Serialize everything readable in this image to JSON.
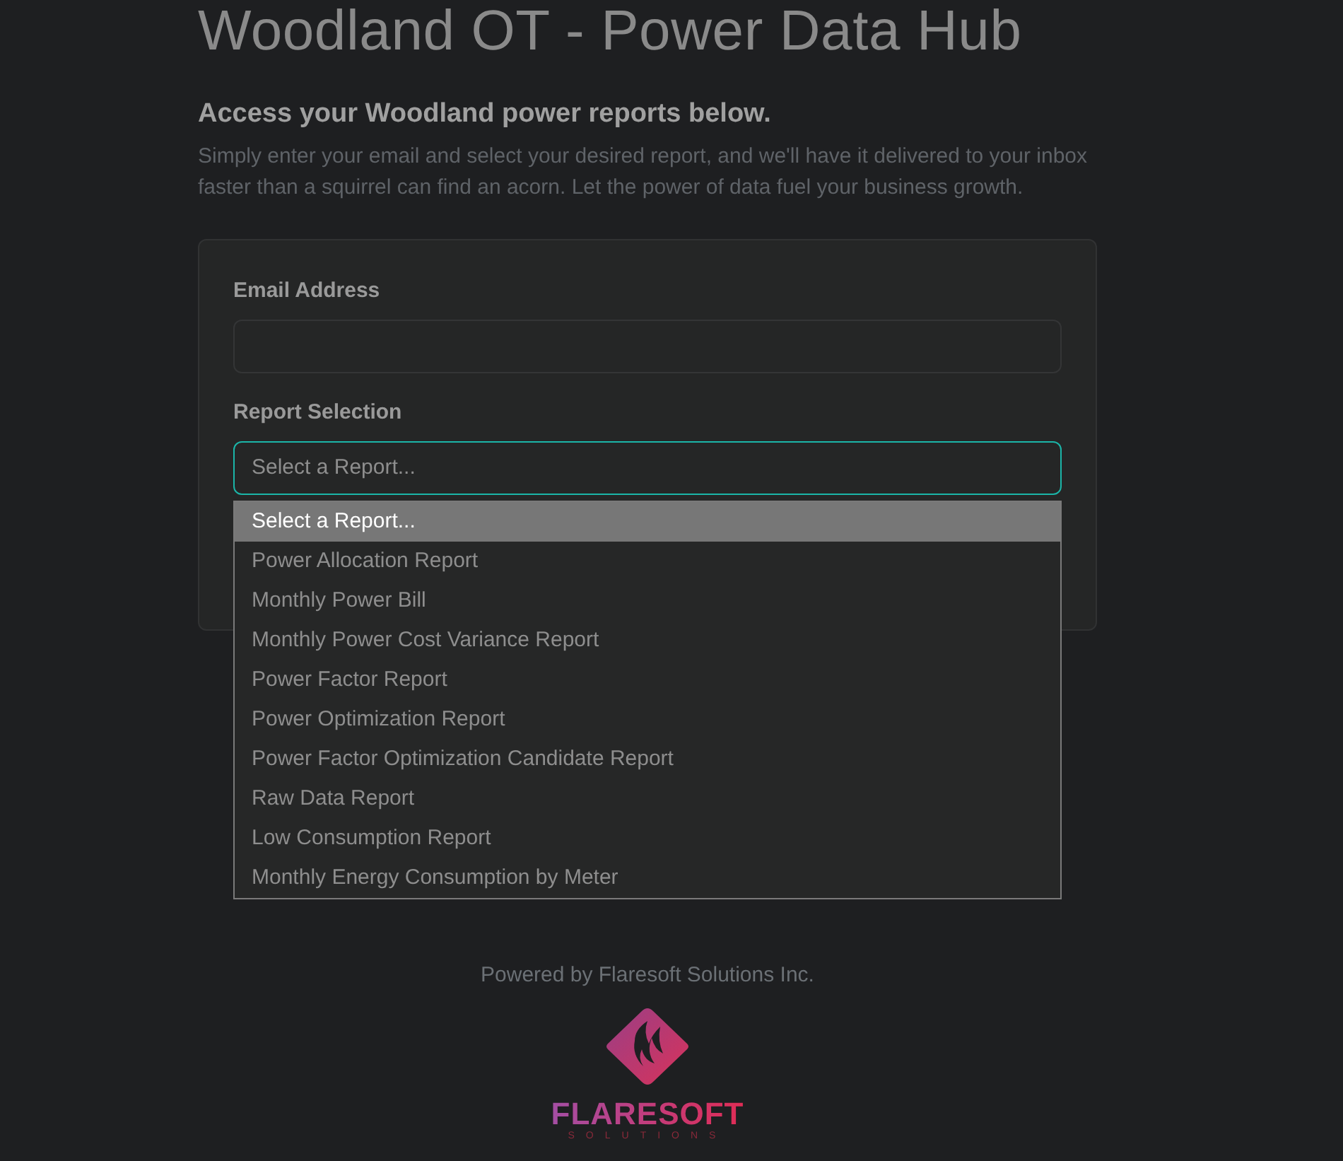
{
  "title": "Woodland OT - Power Data Hub",
  "intro": {
    "heading": "Access your Woodland power reports below.",
    "text": "Simply enter your email and select your desired report, and we'll have it delivered to your inbox faster than a squirrel can find an acorn. Let the power of data fuel your business growth."
  },
  "form": {
    "fields": [
      {
        "kind": "input",
        "label": "Email Address"
      },
      {
        "kind": "select",
        "label": "Report Selection",
        "value": "Select a Report...",
        "focused": true,
        "expanded": true,
        "options": [
          {
            "label": "Select a Report...",
            "selected": true
          },
          {
            "label": "Power Allocation Report",
            "selected": false
          },
          {
            "label": "Monthly Power Bill",
            "selected": false
          },
          {
            "label": "Monthly Power Cost Variance Report",
            "selected": false
          },
          {
            "label": "Power Factor Report",
            "selected": false
          },
          {
            "label": "Power Optimization Report",
            "selected": false
          },
          {
            "label": "Power Factor Optimization Candidate Report",
            "selected": false
          },
          {
            "label": "Raw Data Report",
            "selected": false
          },
          {
            "label": "Low Consumption Report",
            "selected": false
          },
          {
            "label": "Monthly Energy Consumption by Meter",
            "selected": false
          }
        ]
      }
    ]
  },
  "footer": {
    "credit": "Powered by Flaresoft Solutions Inc.",
    "logo": {
      "wordmark": "FLARESOFT",
      "tagline": "SOLUTIONS"
    }
  }
}
